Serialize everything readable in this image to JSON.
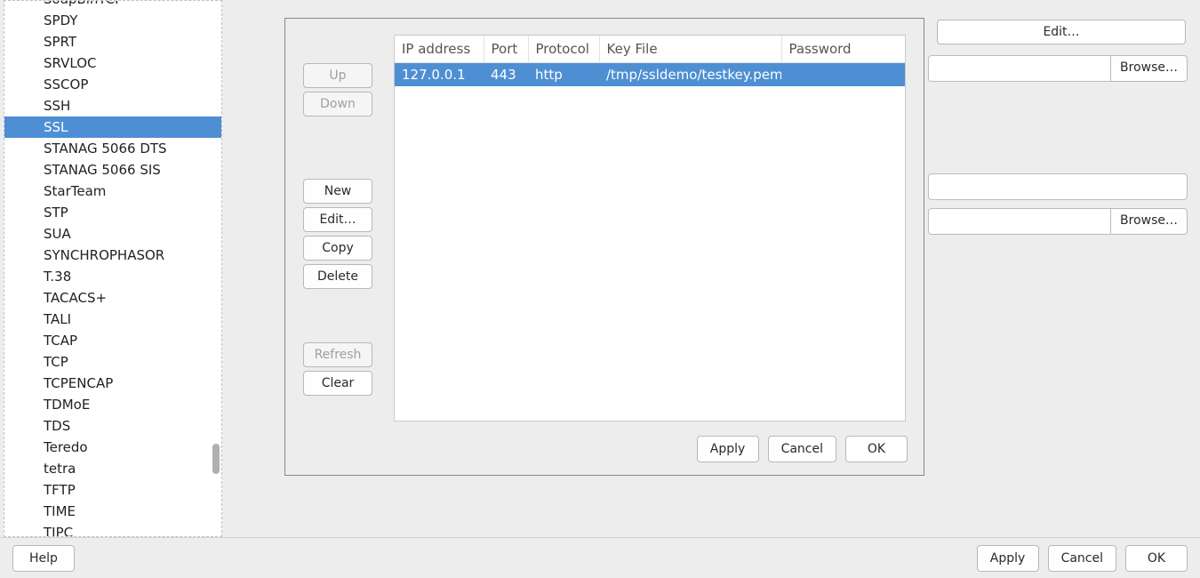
{
  "protocol_list": {
    "selected_index": 6,
    "items": [
      "SoapBinTCP",
      "SPDY",
      "SPRT",
      "SRVLOC",
      "SSCOP",
      "SSH",
      "SSL",
      "STANAG 5066 DTS",
      "STANAG 5066 SIS",
      "StarTeam",
      "STP",
      "SUA",
      "SYNCHROPHASOR",
      "T.38",
      "TACACS+",
      "TALI",
      "TCAP",
      "TCP",
      "TCPENCAP",
      "TDMoE",
      "TDS",
      "Teredo",
      "tetra",
      "TFTP",
      "TIME",
      "TIPC"
    ]
  },
  "dialog": {
    "side_buttons": {
      "up": "Up",
      "down": "Down",
      "new": "New",
      "edit": "Edit…",
      "copy": "Copy",
      "delete": "Delete",
      "refresh": "Refresh",
      "clear": "Clear"
    },
    "table": {
      "headers": {
        "ip": "IP address",
        "port": "Port",
        "protocol": "Protocol",
        "keyfile": "Key File",
        "password": "Password"
      },
      "rows": [
        {
          "ip": "127.0.0.1",
          "port": "443",
          "protocol": "http",
          "keyfile": "/tmp/ssldemo/testkey.pem",
          "password": ""
        }
      ]
    },
    "footer": {
      "apply": "Apply",
      "cancel": "Cancel",
      "ok": "OK"
    }
  },
  "right": {
    "edit": "Edit…",
    "browse": "Browse…",
    "input1_value": "",
    "input2_value": "",
    "input3_value": ""
  },
  "outer_footer": {
    "help": "Help",
    "apply": "Apply",
    "cancel": "Cancel",
    "ok": "OK"
  }
}
